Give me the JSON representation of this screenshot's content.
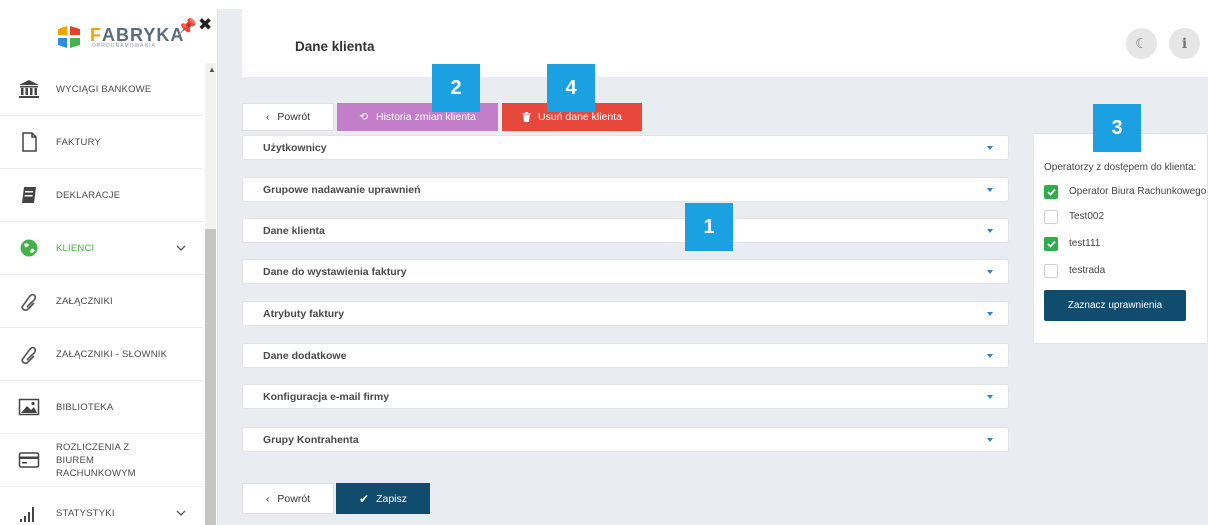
{
  "brand": {
    "name_a": "F",
    "name_b": "ABRYKA",
    "subtitle": "OPROGRAMOWANIA"
  },
  "sidebar": {
    "items": [
      {
        "label": "WYCIĄGI BANKOWE"
      },
      {
        "label": "FAKTURY"
      },
      {
        "label": "DEKLARACJE"
      },
      {
        "label": "KLIENCI",
        "active": true
      },
      {
        "label": "ZAŁĄCZNIKI"
      },
      {
        "label": "ZAŁĄCZNIKI - SŁOWNIK"
      },
      {
        "label": "BIBLIOTEKA"
      },
      {
        "label": "ROZLICZENIA Z BIUREM RACHUNKOWYM"
      },
      {
        "label": "STATYSTYKI"
      }
    ]
  },
  "header": {
    "title": "Dane klienta"
  },
  "toolbar": {
    "back_label": "Powrót",
    "history_label": "Historia zmian klienta",
    "delete_label": "Usuń dane klienta"
  },
  "sections": [
    {
      "title": "Użytkownicy"
    },
    {
      "title": "Grupowe nadawanie uprawnień"
    },
    {
      "title": "Dane klienta"
    },
    {
      "title": "Dane do wystawienia faktury"
    },
    {
      "title": "Atrybuty faktury"
    },
    {
      "title": "Dane dodatkowe"
    },
    {
      "title": "Konfiguracja e-mail firmy"
    },
    {
      "title": "Grupy Kontrahenta"
    }
  ],
  "footer": {
    "back_label": "Powrót",
    "save_label": "Zapisz"
  },
  "operators_panel": {
    "heading": "Operatorzy z dostępem do klienta:",
    "operators": [
      {
        "name": "Operator Biura Rachunkowego",
        "checked": true
      },
      {
        "name": "Test002",
        "checked": false
      },
      {
        "name": "test111",
        "checked": true
      },
      {
        "name": "testrada",
        "checked": false
      }
    ],
    "button_label": "Zaznacz uprawnienia"
  },
  "callouts": {
    "c1": "1",
    "c2": "2",
    "c3": "3",
    "c4": "4"
  },
  "colors": {
    "accent": "#0f4c6e",
    "active_green": "#43b24a",
    "history": "#c27ec8",
    "delete": "#e8483b",
    "callout": "#1ba1e2"
  }
}
